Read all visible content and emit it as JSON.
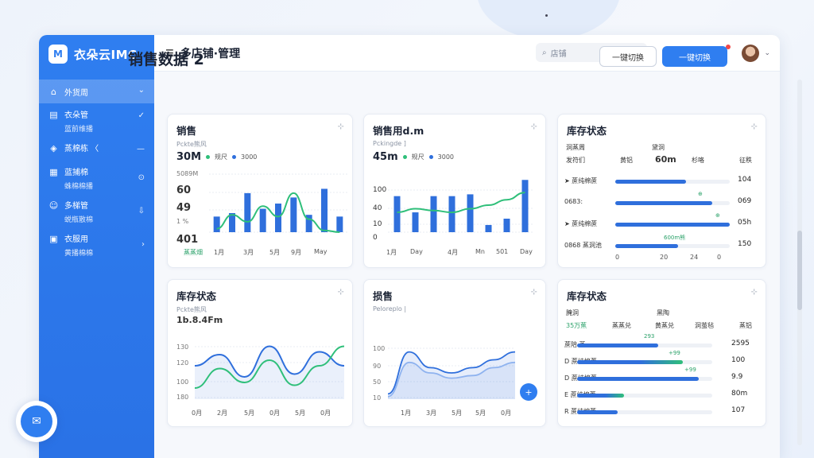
{
  "app": {
    "logo_mark": "M",
    "logo_text": "衣朵云IMC",
    "header_title": "多店铺·管理"
  },
  "search": {
    "placeholder": "店铺"
  },
  "page": {
    "title": "销售数据 2",
    "btn_ghost": "一键切换",
    "btn_primary": "一键切换"
  },
  "sidebar": {
    "items": [
      {
        "label": "外货周",
        "sub": "",
        "icon": "store-icon",
        "chev": "⌄"
      },
      {
        "label": "衣朵管",
        "sub": "蓝前维播",
        "icon": "shop-icon",
        "chev": "✓"
      },
      {
        "label": "蒸棉栋 〈",
        "sub": "",
        "icon": "box-icon",
        "chev": "—"
      },
      {
        "label": "蓝捕棉",
        "sub": "蛛棉棉播",
        "icon": "doc-icon",
        "chev": "⊙"
      },
      {
        "label": "多梯管",
        "sub": "蜕瓶散棉",
        "icon": "smile-icon",
        "chev": "⇩"
      },
      {
        "label": "衣服用",
        "sub": "黄播棉棉",
        "icon": "folder-icon",
        "chev": "›"
      }
    ]
  },
  "icons": {
    "menu": "menu-icon",
    "search": "search-icon",
    "shield": "shield-icon",
    "face": "face-icon",
    "bell": "bell-icon"
  },
  "colors": {
    "primary": "#2f7ef0",
    "series_blue": "#2f6fdc",
    "series_green": "#2fbf7a"
  },
  "cards": [
    {
      "title": "销售",
      "sub": "Pckte熊风",
      "big": "30M",
      "legend_a": "规尺",
      "legend_b": "3000",
      "y_labels": [
        "5089M",
        "60",
        "49",
        "1 %",
        "401"
      ],
      "y_small": [
        "1%",
        "1ms"
      ],
      "x_labels": [
        "1月",
        "3月",
        "5月",
        "9月",
        "May",
        "1月"
      ],
      "x_green": "蒸蒸畑",
      "chart_data": {
        "type": "bar",
        "categories": [
          "1月",
          "3月",
          "5月",
          "9月",
          "May",
          "1月"
        ],
        "values": [
          18,
          22,
          45,
          27,
          33,
          40,
          20,
          50,
          18
        ],
        "line": [
          4,
          20,
          12,
          30,
          18,
          45,
          15,
          2,
          0
        ]
      }
    },
    {
      "title": "销售用d.m",
      "sub": "Pckingde ]",
      "big": "45m",
      "legend_a": "规尺",
      "legend_b": "3000",
      "y_labels": [
        "100",
        "40",
        "10",
        "0",
        "10"
      ],
      "x_labels": [
        "1月",
        "Day",
        "4月",
        "Mn",
        "501",
        "Day"
      ],
      "x_green": "1月",
      "chart_data": {
        "type": "bar",
        "categories": [
          "1月",
          "Day",
          "4月",
          "Mn",
          "501",
          "Day"
        ],
        "values": [
          40,
          22,
          40,
          40,
          42,
          8,
          15,
          58
        ],
        "line": [
          22,
          26,
          24,
          22,
          26,
          30,
          36,
          44
        ]
      }
    },
    {
      "title": "库存状态",
      "head_a": "洞蒸周",
      "head_b": "黛洞",
      "header_row": [
        "发符们",
        "黄铝",
        "60m",
        "杉咯",
        "征秩"
      ],
      "rows": [
        {
          "label": "➤ 蔗纯棉蔗",
          "value": "104",
          "fill": 0.62,
          "note": ""
        },
        {
          "label": "0683:",
          "value": "069",
          "fill": 0.85,
          "note": "⊕"
        },
        {
          "label": "➤ 蔗纯棉蔗",
          "value": "05h",
          "fill": 1.0,
          "note": "⊕"
        },
        {
          "label": "0868 蒸洞池",
          "value": "150",
          "fill": 0.55,
          "note": "600m熊"
        }
      ],
      "chart_data": {
        "type": "bar",
        "categories": [
          "蔗纯棉蔗",
          "0683",
          "蔗纯棉蔗",
          "0868"
        ],
        "values": [
          0.62,
          0.85,
          1.0,
          0.55
        ]
      },
      "x_labels": [
        "0",
        "20",
        "24",
        "0"
      ]
    },
    {
      "title": "库存状态",
      "sub": "Pckte熊风",
      "big": "1b.8.4Fm",
      "y_labels": [
        "130",
        "120",
        "100",
        "180"
      ],
      "x_labels": [
        "0月",
        "2月",
        "5月",
        "0月",
        "5月",
        "0月"
      ],
      "chart_data": {
        "type": "line",
        "series": [
          {
            "values": [
              60,
              80,
              40,
              95,
              45,
              85,
              60
            ]
          },
          {
            "values": [
              20,
              55,
              30,
              70,
              25,
              60,
              95
            ]
          }
        ]
      }
    },
    {
      "title": "损售",
      "sub": "Peloreplo |",
      "y_labels": [
        "100",
        "90",
        "50",
        "10"
      ],
      "x_labels": [
        "1月",
        "3月",
        "5月",
        "5月",
        "0月"
      ],
      "chart_data": {
        "type": "area",
        "series": [
          {
            "values": [
              10,
              90,
              60,
              50,
              60,
              75,
              90
            ]
          },
          {
            "values": [
              5,
              70,
              50,
              40,
              45,
              60,
              70
            ]
          }
        ]
      }
    },
    {
      "title": "库存状态",
      "head_a": "腌洞",
      "head_b": "黑陶",
      "header_row": [
        "35万蕉",
        "蒸蒸兑",
        "黄蒸兑",
        "洞茧毡",
        "蒸铝"
      ],
      "rows": [
        {
          "label": "蔗陪 蒸",
          "value": "2595",
          "fill": 0.6,
          "note": "293"
        },
        {
          "label": "D 蔗纯棉蔗",
          "value": "100",
          "fill": 0.78,
          "note": "+99"
        },
        {
          "label": "D 蔗纯棉蔗",
          "value": "9.9",
          "fill": 0.9,
          "note": "+99"
        },
        {
          "label": "E 蔗纯棉蔗",
          "value": "80m",
          "fill": 0.35,
          "note": ""
        },
        {
          "label": "R 蔗纯棉蔗",
          "value": "107",
          "fill": 0.3,
          "note": ""
        }
      ],
      "chart_data": {
        "type": "bar",
        "categories": [
          "蔗陪",
          "D1",
          "D2",
          "E",
          "R"
        ],
        "values": [
          0.6,
          0.78,
          0.9,
          0.35,
          0.3
        ]
      }
    }
  ]
}
